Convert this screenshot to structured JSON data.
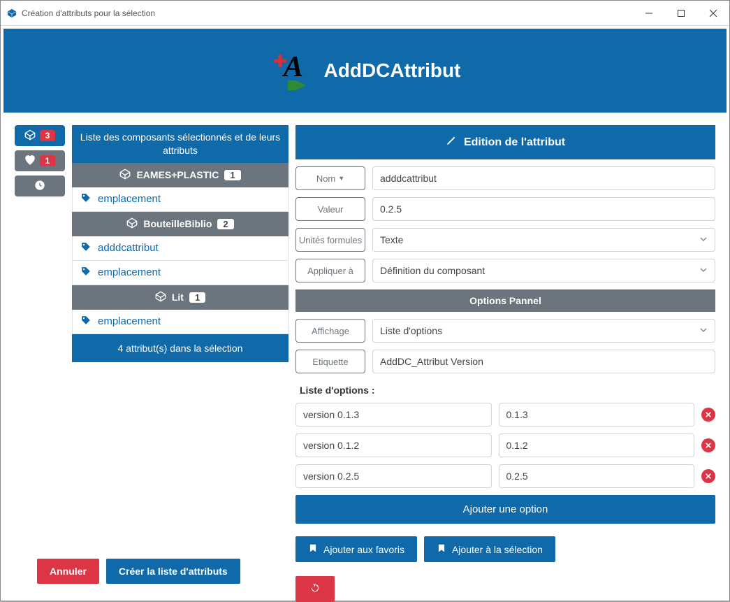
{
  "window": {
    "title": "Création d'attributs pour la sélection"
  },
  "banner": {
    "title": "AddDCAttribut"
  },
  "sidebar": {
    "cube_count": "3",
    "heart_count": "1"
  },
  "components": {
    "header": "Liste des composants sélectionnés et de leurs attributs",
    "items": [
      {
        "name": "EAMES+PLASTIC",
        "count": "1",
        "attrs": [
          "emplacement"
        ]
      },
      {
        "name": "BouteilleBiblio",
        "count": "2",
        "attrs": [
          "adddcattribut",
          "emplacement"
        ]
      },
      {
        "name": "Lit",
        "count": "1",
        "attrs": [
          "emplacement"
        ]
      }
    ],
    "footer": "4 attribut(s) dans la sélection"
  },
  "editor": {
    "title": "Edition de l'attribut",
    "labels": {
      "nom": "Nom",
      "valeur": "Valeur",
      "unites": "Unités formules",
      "appliquer": "Appliquer à",
      "affichage": "Affichage",
      "etiquette": "Etiquette"
    },
    "values": {
      "nom": "adddcattribut",
      "valeur": "0.2.5",
      "unites": "Texte",
      "appliquer": "Définition du composant",
      "affichage": "Liste d'options",
      "etiquette": "AddDC_Attribut Version"
    },
    "options_panel": "Options Pannel",
    "options_title": "Liste d'options :",
    "options": [
      {
        "label": "version 0.1.3",
        "value": "0.1.3"
      },
      {
        "label": "version 0.1.2",
        "value": "0.1.2"
      },
      {
        "label": "version 0.2.5",
        "value": "0.2.5"
      }
    ],
    "add_option": "Ajouter une option",
    "add_fav": "Ajouter aux favoris",
    "add_sel": "Ajouter à la sélection"
  },
  "bottom": {
    "cancel": "Annuler",
    "create": "Créer la liste d'attributs"
  }
}
